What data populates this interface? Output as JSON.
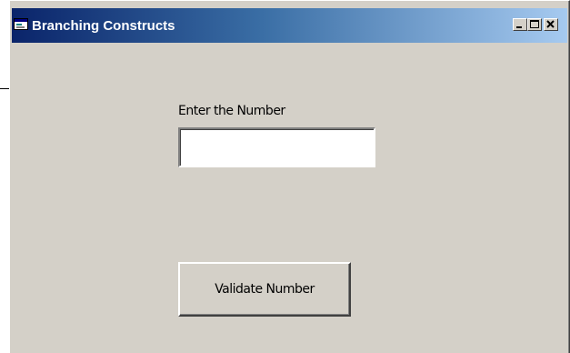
{
  "window": {
    "title": "Branching Constructs",
    "icon": "form-window-icon",
    "controls": {
      "minimize": "minimize-icon",
      "maximize": "maximize-icon",
      "close": "close-icon"
    },
    "colors": {
      "face": "#d4d0c8",
      "title_gradient_start": "#0a246a",
      "title_gradient_end": "#a6caf0"
    }
  },
  "form": {
    "number_label": "Enter the Number",
    "number_value": "",
    "validate_button_label": "Validate Number"
  }
}
